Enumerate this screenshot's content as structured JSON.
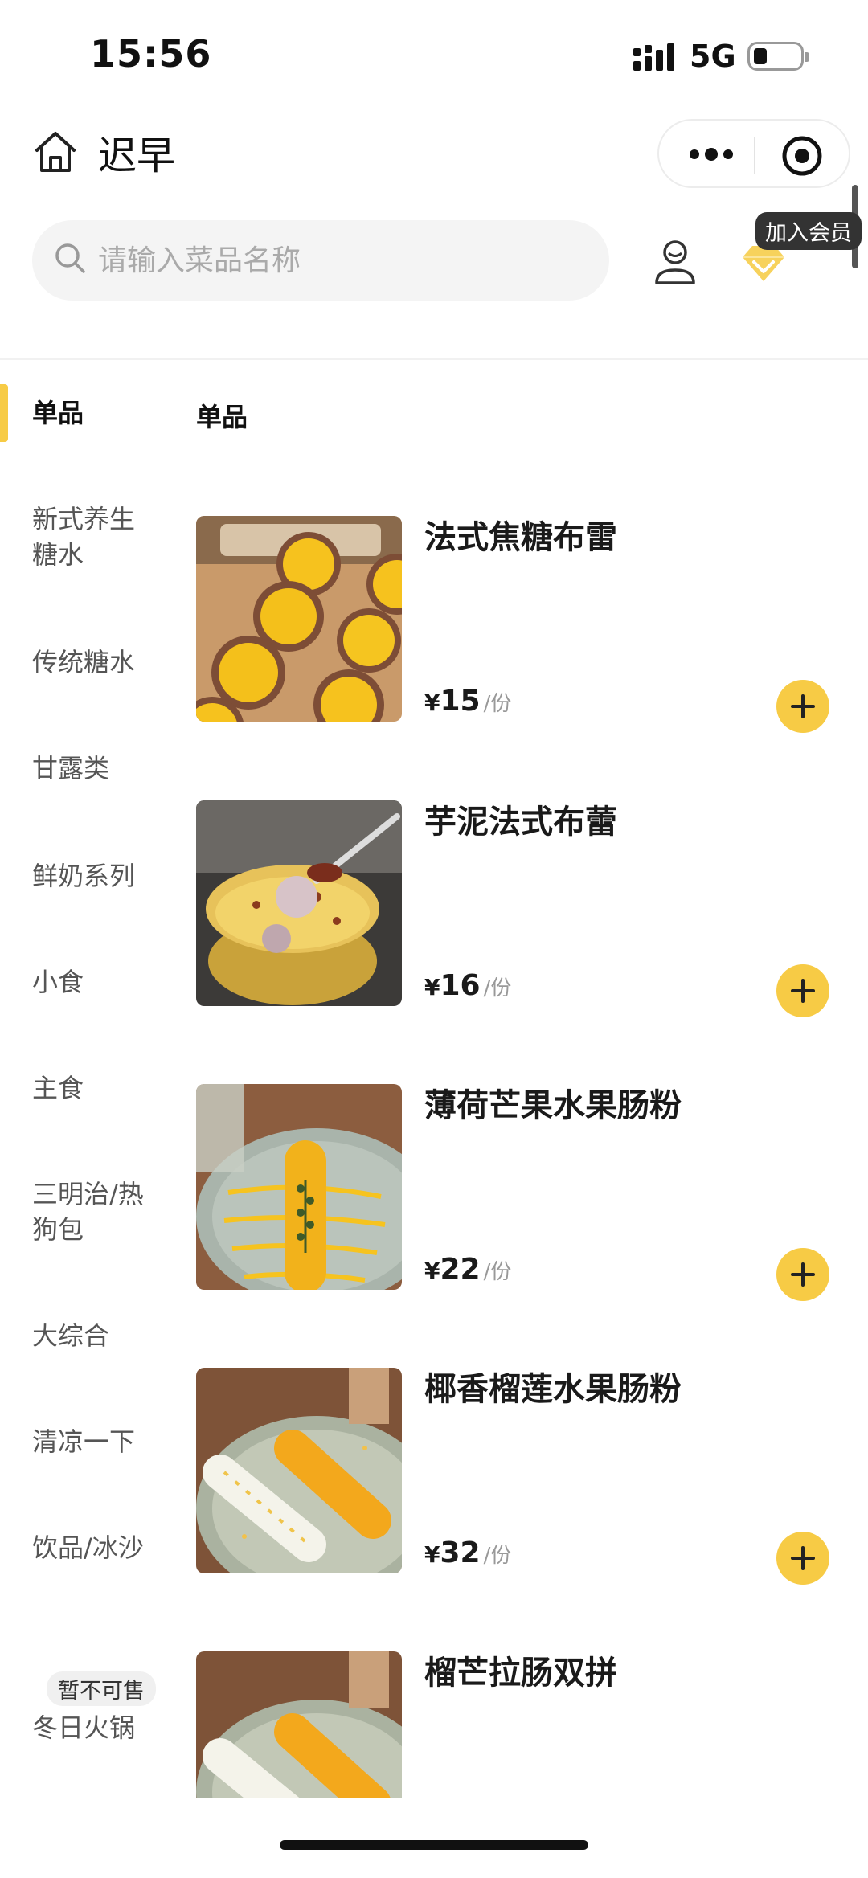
{
  "status_bar": {
    "time": "15:56",
    "network": "5G"
  },
  "header": {
    "store_name": "迟早"
  },
  "search": {
    "placeholder": "请输入菜品名称"
  },
  "member": {
    "badge_label": "加入会员"
  },
  "sidebar": {
    "items": [
      {
        "label": "单品",
        "active": true
      },
      {
        "label": "新式养生糖水"
      },
      {
        "label": "传统糖水"
      },
      {
        "label": "甘露类"
      },
      {
        "label": "鲜奶系列"
      },
      {
        "label": "小食"
      },
      {
        "label": "主食"
      },
      {
        "label": "三明治/热狗包"
      },
      {
        "label": "大综合"
      },
      {
        "label": "清凉一下"
      },
      {
        "label": "饮品/冰沙"
      },
      {
        "label": "冬日火锅",
        "badge": "暂不可售"
      }
    ]
  },
  "section": {
    "title": "单品"
  },
  "products": [
    {
      "name": "法式焦糖布雷",
      "currency": "¥",
      "price": "15",
      "unit": "/份"
    },
    {
      "name": "芋泥法式布蕾",
      "currency": "¥",
      "price": "16",
      "unit": "/份"
    },
    {
      "name": "薄荷芒果水果肠粉",
      "currency": "¥",
      "price": "22",
      "unit": "/份"
    },
    {
      "name": "椰香榴莲水果肠粉",
      "currency": "¥",
      "price": "32",
      "unit": "/份"
    },
    {
      "name": "榴芒拉肠双拼"
    }
  ],
  "colors": {
    "accent": "#f7cb45",
    "search_bg": "#f4f4f4",
    "text": "#1a1a1a"
  }
}
